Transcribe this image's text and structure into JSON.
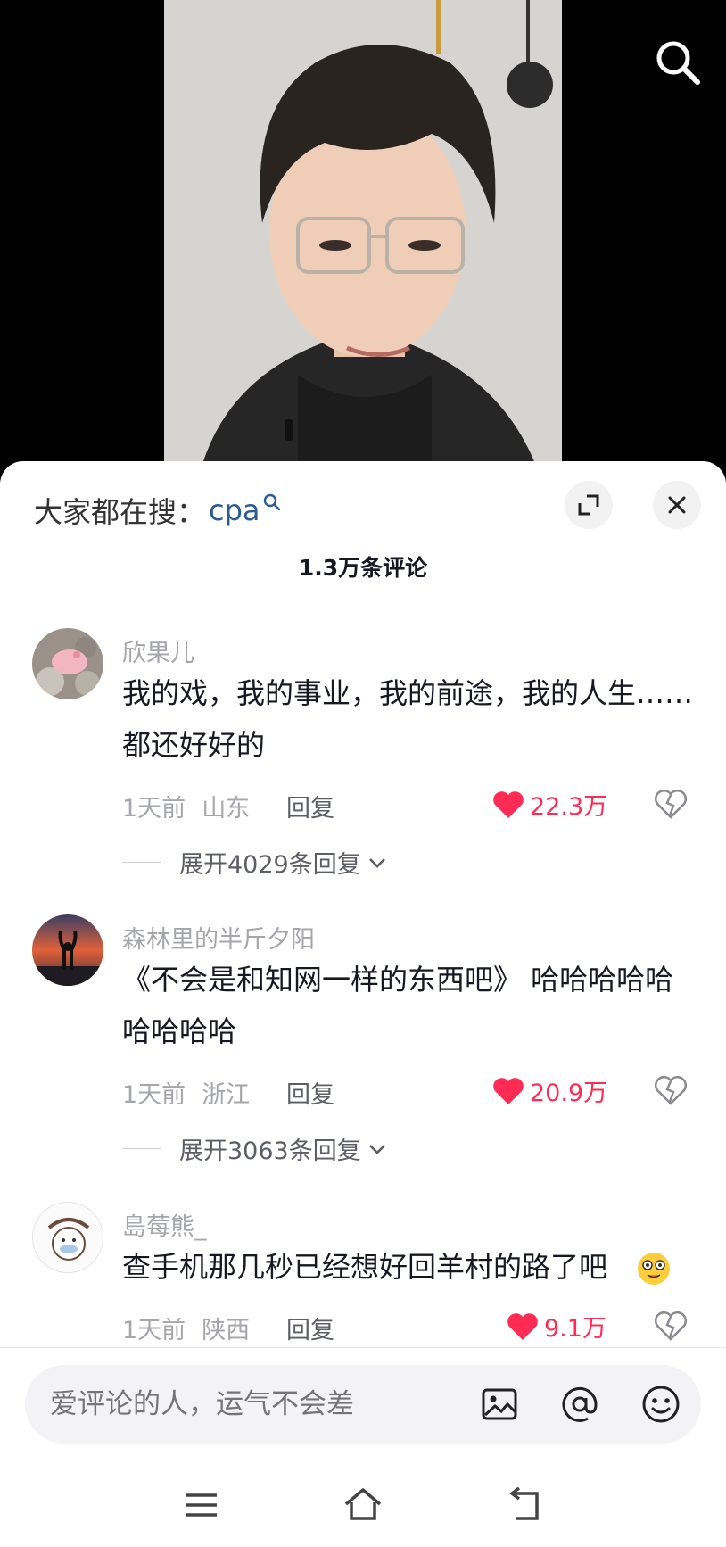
{
  "hot_search": {
    "label": "大家都在搜：",
    "term": "cpa"
  },
  "comment_count": "1.3万条评论",
  "comments": [
    {
      "user": "欣果儿",
      "text": "我的戏，我的事业，我的前途，我的人生……都还好好的",
      "time": "1天前",
      "location": "山东",
      "reply_label": "回复",
      "likes": "22.3万",
      "expand": "展开4029条回复"
    },
    {
      "user": "森林里的半斤夕阳",
      "text": "《不会是和知网一样的东西吧》 哈哈哈哈哈哈哈哈哈",
      "time": "1天前",
      "location": "浙江",
      "reply_label": "回复",
      "likes": "20.9万",
      "expand": "展开3063条回复"
    },
    {
      "user": "島莓熊_",
      "text": "查手机那几秒已经想好回羊村的路了吧",
      "time": "1天前",
      "location": "陕西",
      "reply_label": "回复",
      "likes": "9.1万"
    }
  ],
  "input": {
    "placeholder": "爱评论的人，运气不会差"
  },
  "colors": {
    "like_red": "#fe2c55",
    "hot_term_blue": "#2b5b94",
    "muted_gray": "#a4a6ab"
  },
  "icons": [
    "search-icon",
    "expand-icon",
    "close-icon",
    "heart-icon",
    "dislike-heart-icon",
    "chevron-down-icon",
    "image-icon",
    "at-icon",
    "emoji-icon",
    "menu-icon",
    "home-icon",
    "back-icon"
  ]
}
